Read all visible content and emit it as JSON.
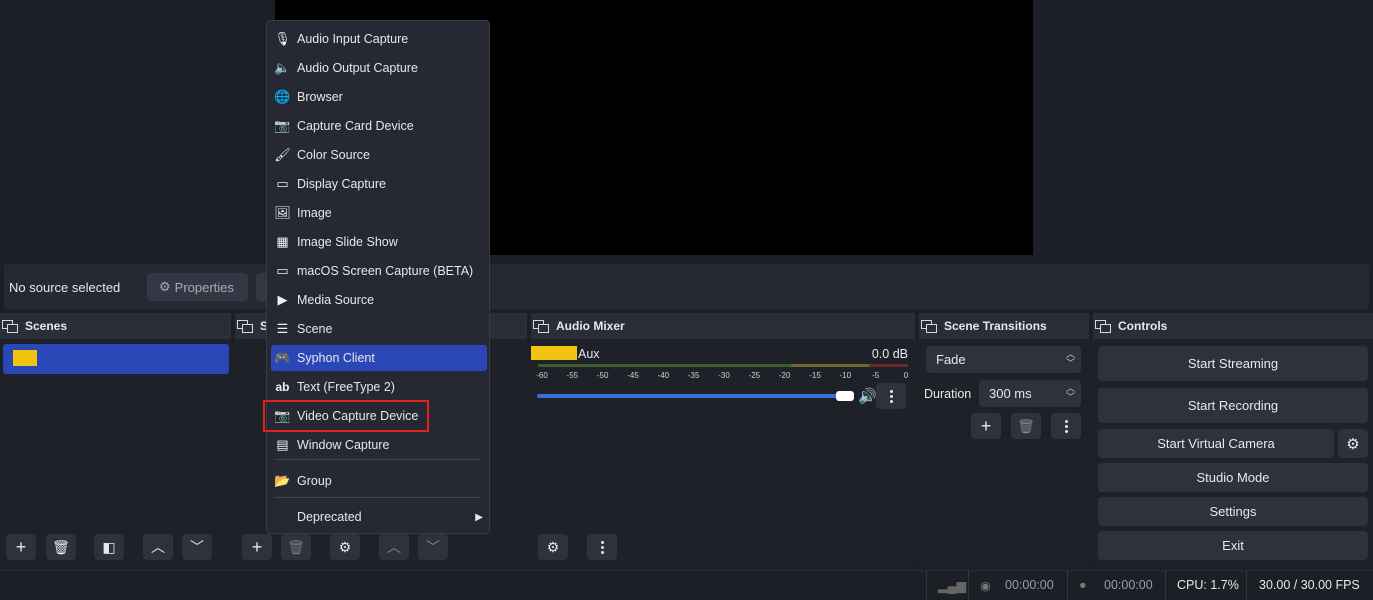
{
  "source_bar": {
    "no_source": "No source selected",
    "properties": "Properties"
  },
  "docks": {
    "scenes": "Scenes",
    "sources": "S",
    "audio_mixer": "Audio Mixer",
    "transitions": "Scene Transitions",
    "controls": "Controls"
  },
  "menu": {
    "items": [
      {
        "label": "Audio Input Capture",
        "icon": "microphone-icon"
      },
      {
        "label": "Audio Output Capture",
        "icon": "speaker-icon"
      },
      {
        "label": "Browser",
        "icon": "globe-icon"
      },
      {
        "label": "Capture Card Device",
        "icon": "camera-icon"
      },
      {
        "label": "Color Source",
        "icon": "brush-icon"
      },
      {
        "label": "Display Capture",
        "icon": "monitor-icon"
      },
      {
        "label": "Image",
        "icon": "image-icon"
      },
      {
        "label": "Image Slide Show",
        "icon": "slideshow-icon"
      },
      {
        "label": "macOS Screen Capture (BETA)",
        "icon": "monitor-icon"
      },
      {
        "label": "Media Source",
        "icon": "play-icon"
      },
      {
        "label": "Scene",
        "icon": "list-icon"
      },
      {
        "label": "Syphon Client",
        "icon": "gamepad-icon"
      },
      {
        "label": "Text (FreeType 2)",
        "icon": "text-icon"
      },
      {
        "label": "Video Capture Device",
        "icon": "camera-icon"
      },
      {
        "label": "Window Capture",
        "icon": "window-icon"
      },
      {
        "label": "Group",
        "icon": "folder-icon"
      },
      {
        "label": "Deprecated",
        "icon": "chevron-right-icon"
      }
    ]
  },
  "mixer": {
    "track": "Aux",
    "level": "0.0 dB",
    "ticks": [
      "-60",
      "-55",
      "-50",
      "-45",
      "-40",
      "-35",
      "-30",
      "-25",
      "-20",
      "-15",
      "-10",
      "-5",
      "0"
    ]
  },
  "transitions": {
    "type": "Fade",
    "duration_label": "Duration",
    "duration_value": "300 ms"
  },
  "controls": {
    "start_streaming": "Start Streaming",
    "start_recording": "Start Recording",
    "start_virtual_camera": "Start Virtual Camera",
    "studio_mode": "Studio Mode",
    "settings": "Settings",
    "exit": "Exit"
  },
  "status": {
    "stream_time": "00:00:00",
    "record_time": "00:00:00",
    "cpu": "CPU: 1.7%",
    "fps": "30.00 / 30.00 FPS"
  },
  "colors": {
    "accent": "#2a47b8",
    "highlight": "#e22222",
    "scene_color": "#f1c40f"
  }
}
